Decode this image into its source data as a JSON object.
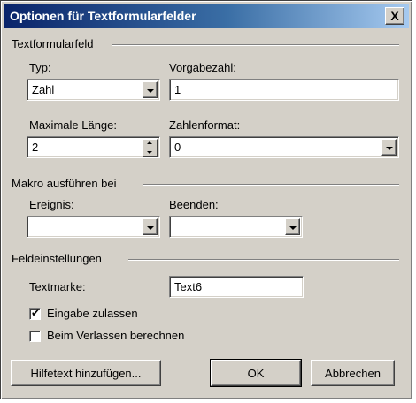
{
  "window": {
    "title": "Optionen für Textformularfelder",
    "close_glyph": "X"
  },
  "textformularfeld": {
    "group_title": "Textformularfeld",
    "typ_label": "Typ:",
    "typ_value": "Zahl",
    "vorgabe_label": "Vorgabezahl:",
    "vorgabe_value": "1",
    "maxlen_label": "Maximale Länge:",
    "maxlen_value": "2",
    "format_label": "Zahlenformat:",
    "format_value": "0"
  },
  "makro": {
    "group_title": "Makro ausführen bei",
    "ereignis_label": "Ereignis:",
    "ereignis_value": "",
    "beenden_label": "Beenden:",
    "beenden_value": ""
  },
  "feldeinstellungen": {
    "group_title": "Feldeinstellungen",
    "textmarke_label": "Textmarke:",
    "textmarke_value": "Text6",
    "eingabe_label": "Eingabe zulassen",
    "eingabe_checked": true,
    "verlassen_label": "Beim Verlassen berechnen",
    "verlassen_checked": false
  },
  "buttons": {
    "hilfetext": "Hilfetext hinzufügen...",
    "ok": "OK",
    "abbrechen": "Abbrechen"
  }
}
